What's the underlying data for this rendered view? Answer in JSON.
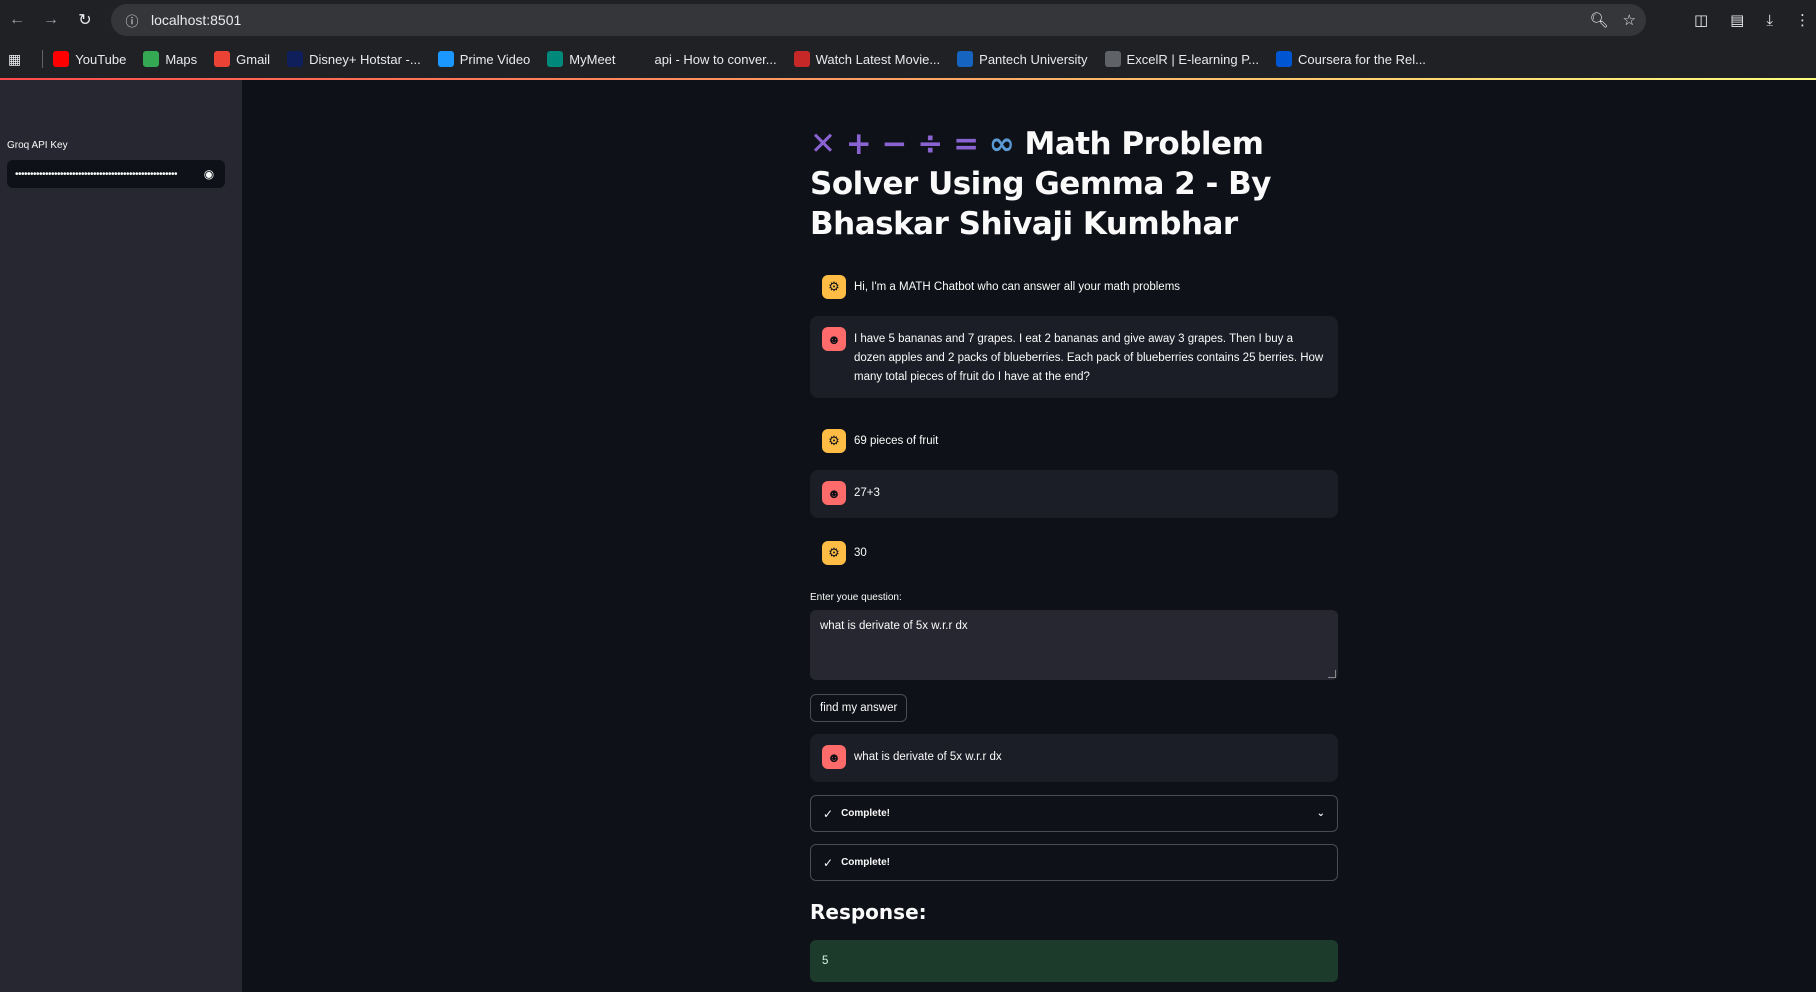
{
  "browser": {
    "url": "localhost:8501",
    "bookmarks": [
      {
        "label": "YouTube",
        "icon": "youtube-icon",
        "color": "#ff0000"
      },
      {
        "label": "Maps",
        "icon": "maps-icon",
        "color": "#34a853"
      },
      {
        "label": "Gmail",
        "icon": "gmail-icon",
        "color": "#ea4335"
      },
      {
        "label": "Disney+ Hotstar -...",
        "icon": "hotstar-icon",
        "color": "#0f1f5c"
      },
      {
        "label": "Prime Video",
        "icon": "prime-video-icon",
        "color": "#1a98ff"
      },
      {
        "label": "MyMeet",
        "icon": "meet-icon",
        "color": "#00897b"
      },
      {
        "label": "api - How to conver...",
        "icon": "stack-icon",
        "color": "#202124"
      },
      {
        "label": "Watch Latest Movie...",
        "icon": "movie-icon",
        "color": "#c62828"
      },
      {
        "label": "Pantech University",
        "icon": "pantech-icon",
        "color": "#1565c0"
      },
      {
        "label": "ExcelR | E-learning P...",
        "icon": "globe-icon",
        "color": "#5f6368"
      },
      {
        "label": "Coursera for the Rel...",
        "icon": "coursera-icon",
        "color": "#0056d2"
      }
    ]
  },
  "sidebar": {
    "api_key_label": "Groq API Key",
    "api_key_value": "••••••••••••••••••••••••••••••••••••••••••••••••••••••"
  },
  "main": {
    "title_symbols": "✕ + − ÷ =",
    "title_infinity": "∞",
    "title_text": "Math Problem Solver Using Gemma 2 - By Bhaskar Shivaji Kumbhar",
    "messages": [
      {
        "role": "assistant",
        "text": "Hi, I'm a MATH Chatbot who can answer all your math problems"
      },
      {
        "role": "user",
        "text": "I have 5 bananas and 7 grapes. I eat 2 bananas and give away 3 grapes. Then I buy a dozen apples and 2 packs of blueberries. Each pack of blueberries contains 25 berries. How many total pieces of fruit do I have at the end?"
      },
      {
        "role": "assistant",
        "text": "69 pieces of fruit"
      },
      {
        "role": "user",
        "text": "27+3"
      },
      {
        "role": "assistant",
        "text": "30"
      }
    ],
    "question_label": "Enter youe question:",
    "question_value": "what is derivate of 5x w.r.r dx",
    "button_label": "find my answer",
    "latest_user_message": "what is derivate of 5x w.r.r dx",
    "status_1": "Complete!",
    "status_2": "Complete!",
    "response_heading": "Response:",
    "response_value": "5"
  }
}
